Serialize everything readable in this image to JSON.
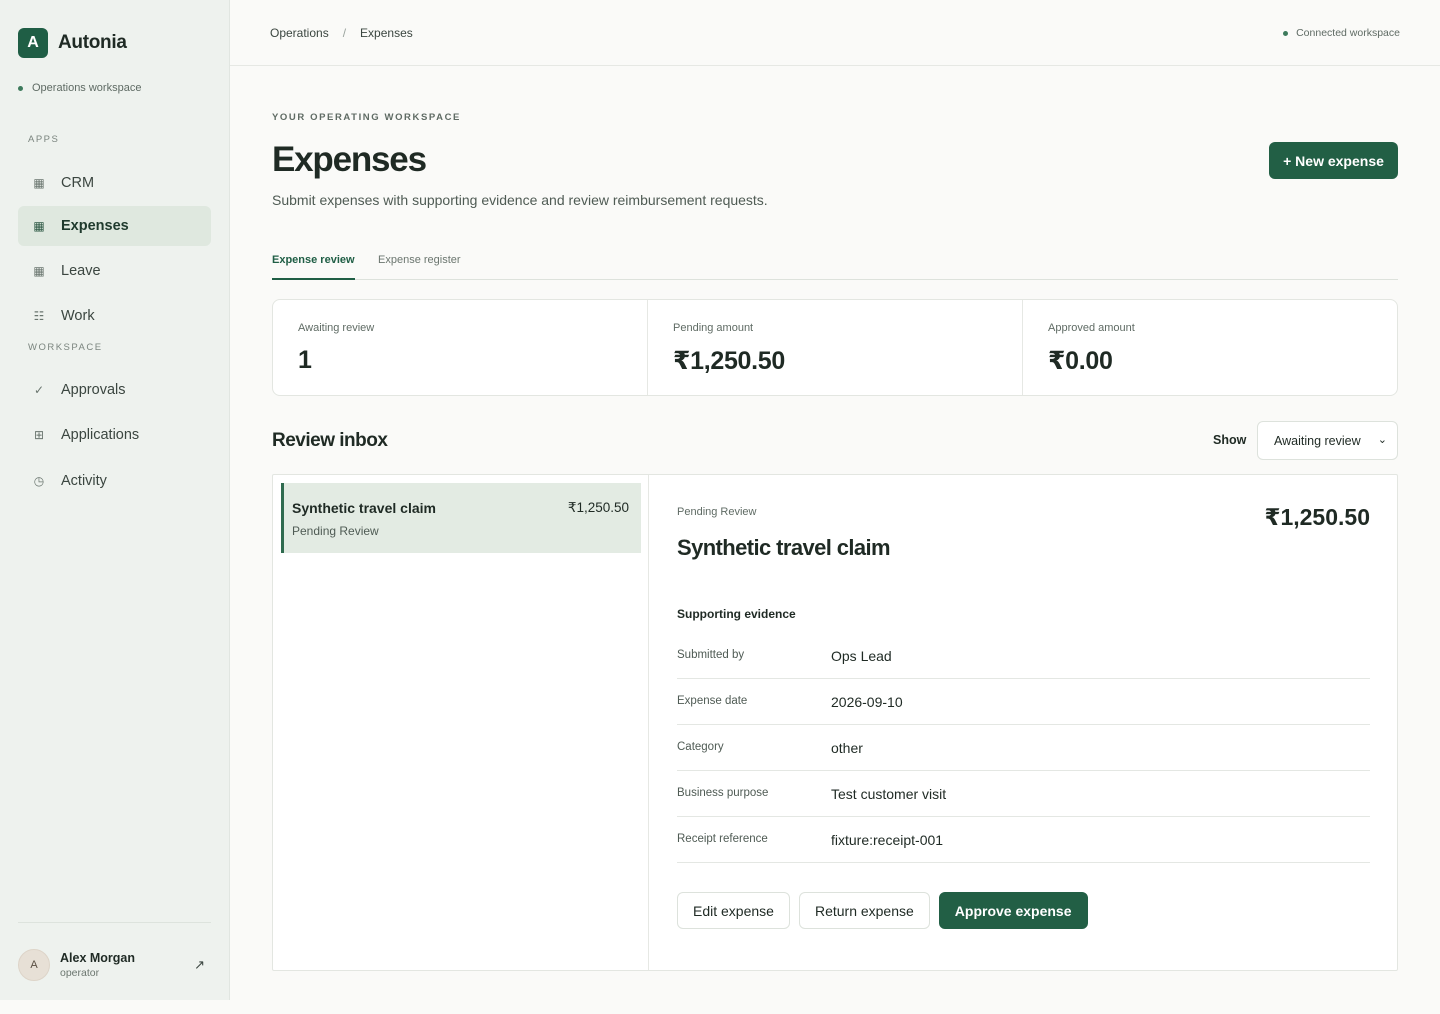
{
  "brand": {
    "mark": "A",
    "name": "Autonia"
  },
  "workspace_label": "Operations workspace",
  "sidebar": {
    "apps_label": "APPS",
    "apps": [
      {
        "label": "CRM",
        "icon": "grid-icon",
        "active": false
      },
      {
        "label": "Expenses",
        "icon": "grid-icon",
        "active": true
      },
      {
        "label": "Leave",
        "icon": "grid-icon",
        "active": false
      },
      {
        "label": "Work",
        "icon": "list-icon",
        "active": false
      }
    ],
    "workspace_label": "WORKSPACE",
    "workspace": [
      {
        "label": "Approvals",
        "icon": "check-icon"
      },
      {
        "label": "Applications",
        "icon": "apps-icon"
      },
      {
        "label": "Activity",
        "icon": "clock-icon"
      }
    ]
  },
  "user": {
    "initial": "A",
    "name": "Alex Morgan",
    "role": "operator"
  },
  "topbar": {
    "breadcrumbs": [
      "Operations",
      "Expenses"
    ],
    "separator": "/",
    "status": "Connected workspace"
  },
  "header": {
    "eyebrow": "YOUR OPERATING WORKSPACE",
    "title": "Expenses",
    "subtitle": "Submit expenses with supporting evidence and review reimbursement requests.",
    "new_button": "+ New expense"
  },
  "tabs": [
    {
      "label": "Expense review",
      "active": true
    },
    {
      "label": "Expense register",
      "active": false
    }
  ],
  "stats": [
    {
      "label": "Awaiting review",
      "value": "1"
    },
    {
      "label": "Pending amount",
      "value": "₹1,250.50"
    },
    {
      "label": "Approved amount",
      "value": "₹0.00"
    }
  ],
  "inbox": {
    "title": "Review inbox",
    "show_label": "Show",
    "filter_value": "Awaiting review",
    "items": [
      {
        "title": "Synthetic travel claim",
        "amount": "₹1,250.50",
        "status": "Pending Review"
      }
    ]
  },
  "detail": {
    "status": "Pending Review",
    "title": "Synthetic travel claim",
    "amount": "₹1,250.50",
    "section_title": "Supporting evidence",
    "fields": [
      {
        "label": "Submitted by",
        "value": "Ops Lead"
      },
      {
        "label": "Expense date",
        "value": "2026-09-10"
      },
      {
        "label": "Category",
        "value": "other"
      },
      {
        "label": "Business purpose",
        "value": "Test customer visit"
      },
      {
        "label": "Receipt reference",
        "value": "fixture:receipt-001"
      }
    ],
    "actions": {
      "edit": "Edit expense",
      "return": "Return expense",
      "approve": "Approve expense"
    }
  },
  "colors": {
    "accent": "#225f45",
    "sidebar_bg": "#eef2ee",
    "active_item_bg": "#dfe8df"
  }
}
